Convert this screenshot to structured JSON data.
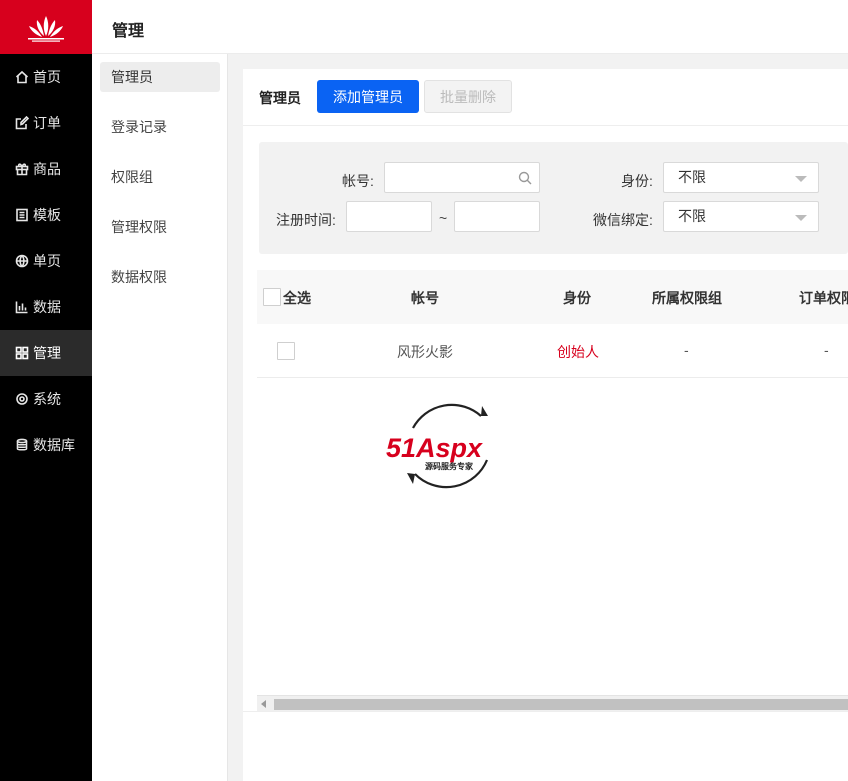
{
  "nav": {
    "items": [
      {
        "label": "首页",
        "icon": "home-icon"
      },
      {
        "label": "订单",
        "icon": "edit-icon"
      },
      {
        "label": "商品",
        "icon": "gift-icon"
      },
      {
        "label": "模板",
        "icon": "template-icon"
      },
      {
        "label": "单页",
        "icon": "globe-icon"
      },
      {
        "label": "数据",
        "icon": "bar-chart-icon"
      },
      {
        "label": "管理",
        "icon": "grid-icon"
      },
      {
        "label": "系统",
        "icon": "gear-icon"
      },
      {
        "label": "数据库",
        "icon": "database-icon"
      }
    ],
    "active_index": 6,
    "logo_color": "#d7001d"
  },
  "header": {
    "title": "管理"
  },
  "submenu": {
    "items": [
      {
        "label": "管理员"
      },
      {
        "label": "登录记录"
      },
      {
        "label": "权限组"
      },
      {
        "label": "管理权限"
      },
      {
        "label": "数据权限"
      }
    ],
    "active_index": 0
  },
  "panel": {
    "title": "管理员",
    "add_button": "添加管理员",
    "delete_button": "批量删除",
    "accent_color": "#0a63f3"
  },
  "filter": {
    "account_label": "帐号:",
    "account_value": "",
    "register_label": "注册时间:",
    "date_from": "",
    "date_to": "",
    "range_sep": "~",
    "role_label": "身份:",
    "role_value": "不限",
    "wechat_label": "微信绑定:",
    "wechat_value": "不限"
  },
  "table": {
    "select_all": "全选",
    "columns": [
      "帐号",
      "身份",
      "所属权限组",
      "订单权限"
    ],
    "rows": [
      {
        "account": "风形火影",
        "role": "创始人",
        "group": "-",
        "order_perm": "-"
      }
    ]
  },
  "watermark": {
    "brand": "51Aspx",
    "slogan": "源码服务专家"
  }
}
